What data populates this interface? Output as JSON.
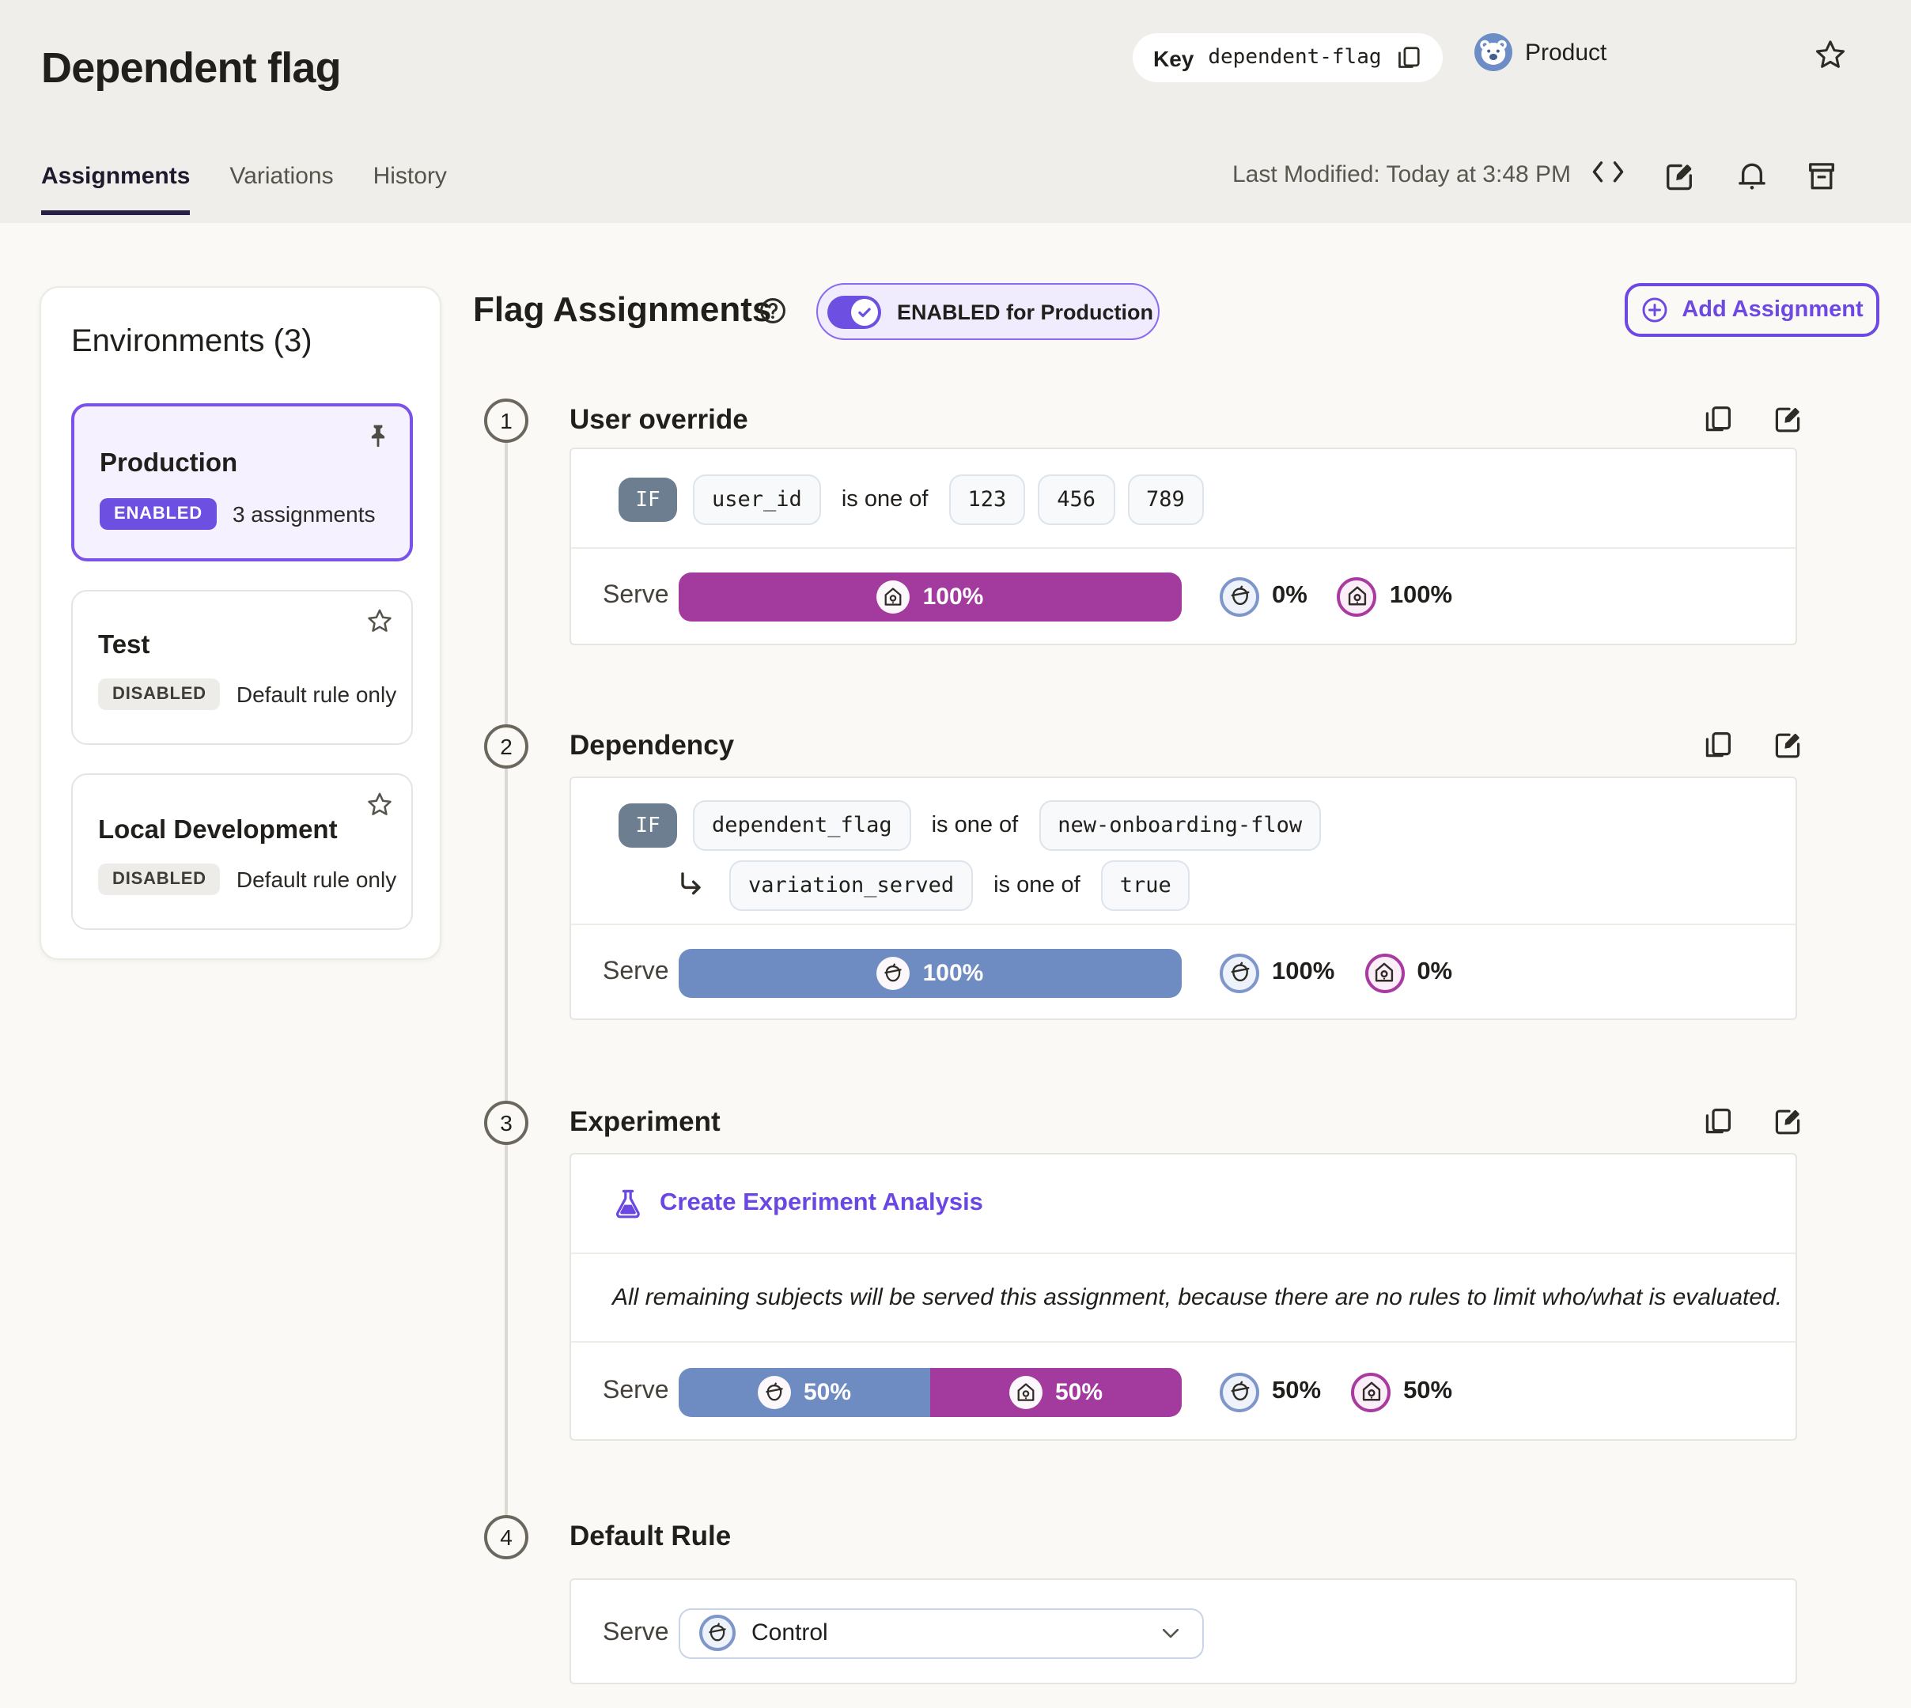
{
  "header": {
    "title": "Dependent flag",
    "key_label": "Key",
    "key_value": "dependent-flag",
    "product_label": "Product",
    "last_modified": "Last Modified: Today at 3:48 PM",
    "tabs": [
      {
        "label": "Assignments"
      },
      {
        "label": "Variations"
      },
      {
        "label": "History"
      }
    ]
  },
  "sidebar": {
    "heading": "Environments (3)",
    "environments": [
      {
        "name": "Production",
        "status": "ENABLED",
        "detail": "3 assignments"
      },
      {
        "name": "Test",
        "status": "DISABLED",
        "detail": "Default rule only"
      },
      {
        "name": "Local Development",
        "status": "DISABLED",
        "detail": "Default rule only"
      }
    ]
  },
  "main": {
    "heading": "Flag Assignments",
    "toggle_label": "ENABLED for Production",
    "add_button_label": "Add Assignment",
    "serve_label": "Serve",
    "if_label": "IF",
    "operator": "is one of",
    "colors": {
      "accent_purple": "#6d4fe2",
      "control_blue": "#6f8cc2",
      "treatment_magenta": "#a33a9e"
    },
    "assignments": [
      {
        "number": "1",
        "title": "User override",
        "rule": {
          "attribute": "user_id",
          "values": [
            "123",
            "456",
            "789"
          ]
        },
        "serve": {
          "bar": [
            {
              "variation": "treatment",
              "pct": "100%"
            }
          ],
          "stats": [
            {
              "variation": "control",
              "pct": "0%"
            },
            {
              "variation": "treatment",
              "pct": "100%"
            }
          ]
        }
      },
      {
        "number": "2",
        "title": "Dependency",
        "rules": [
          {
            "attribute": "dependent_flag",
            "values": [
              "new-onboarding-flow"
            ]
          },
          {
            "attribute": "variation_served",
            "values": [
              "true"
            ]
          }
        ],
        "serve": {
          "bar": [
            {
              "variation": "control",
              "pct": "100%"
            }
          ],
          "stats": [
            {
              "variation": "control",
              "pct": "100%"
            },
            {
              "variation": "treatment",
              "pct": "0%"
            }
          ]
        }
      },
      {
        "number": "3",
        "title": "Experiment",
        "link_label": "Create Experiment Analysis",
        "note": "All remaining subjects will be served this assignment, because there are no rules to limit who/what is evaluated.",
        "serve": {
          "bar": [
            {
              "variation": "control",
              "pct": "50%"
            },
            {
              "variation": "treatment",
              "pct": "50%"
            }
          ],
          "stats": [
            {
              "variation": "control",
              "pct": "50%"
            },
            {
              "variation": "treatment",
              "pct": "50%"
            }
          ]
        }
      },
      {
        "number": "4",
        "title": "Default Rule",
        "dropdown_value": "Control"
      }
    ]
  }
}
